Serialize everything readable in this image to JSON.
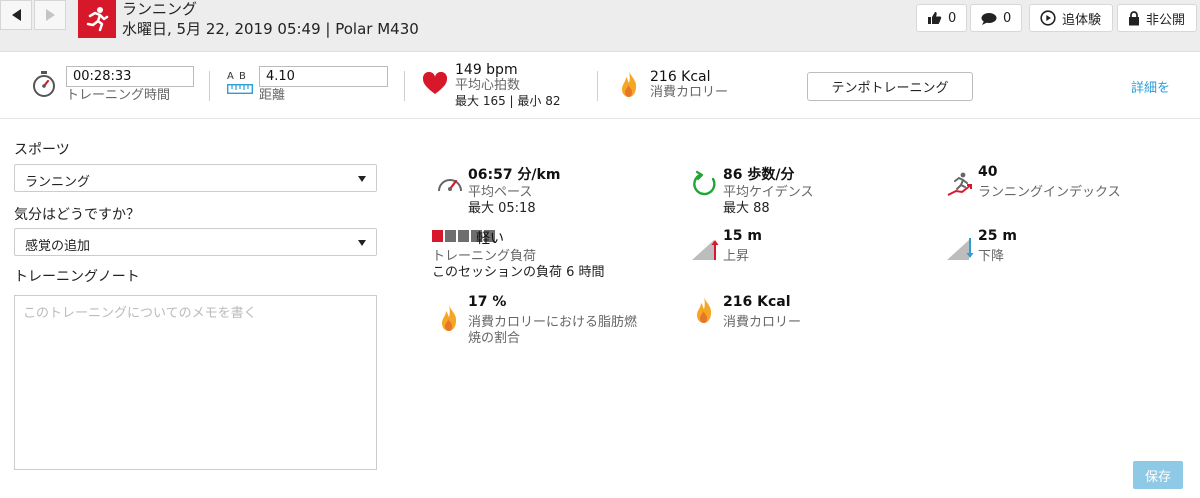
{
  "header": {
    "title": "ランニング",
    "subtitle": "水曜日, 5月 22, 2019 05:49 | Polar M430",
    "like_count": "0",
    "comment_count": "0",
    "relive_label": "追体験",
    "privacy_label": "非公開"
  },
  "summary": {
    "duration_value": "00:28:33",
    "duration_label": "トレーニング時間",
    "distance_ab": "A  B",
    "distance_value": "4.10",
    "distance_label": "距離",
    "hr_value": "149 bpm",
    "hr_label": "平均心拍数",
    "hr_minmax": "最大 165  |  最小 82",
    "calories_value": "216 Kcal",
    "calories_label": "消費カロリー",
    "tempo_button": "テンポトレーニング",
    "detail_link": "詳細を"
  },
  "form": {
    "sport_label": "スポーツ",
    "sport_value": "ランニング",
    "feeling_label": "気分はどうですか？",
    "feeling_value": "感覚の追加",
    "notes_label": "トレーニングノート",
    "notes_placeholder": "このトレーニングについてのメモを書く"
  },
  "stats": {
    "pace_value": "06:57 分/km",
    "pace_label": "平均ペース",
    "pace_sub": "最大 05:18",
    "cadence_value": "86 歩数/分",
    "cadence_label": "平均ケイデンス",
    "cadence_sub": "最大 88",
    "index_value": "40",
    "index_label": "ランニングインデックス",
    "load_value": "軽い",
    "load_label": "トレーニング負荷",
    "load_sub": "このセッションの負荷 6 時間",
    "load_level": 1,
    "load_max": 5,
    "ascent_value": "15 m",
    "ascent_label": "上昇",
    "descent_value": "25 m",
    "descent_label": "下降",
    "fat_value": "17 %",
    "fat_label_1": "消費カロリーにおける脂肪燃",
    "fat_label_2": "焼の割合",
    "kcal_value": "216 Kcal",
    "kcal_label": "消費カロリー"
  },
  "save_label": "保存",
  "colors": {
    "accent_red": "#d7182a",
    "link_blue": "#2d9fd7",
    "flame": "#f5a623"
  }
}
